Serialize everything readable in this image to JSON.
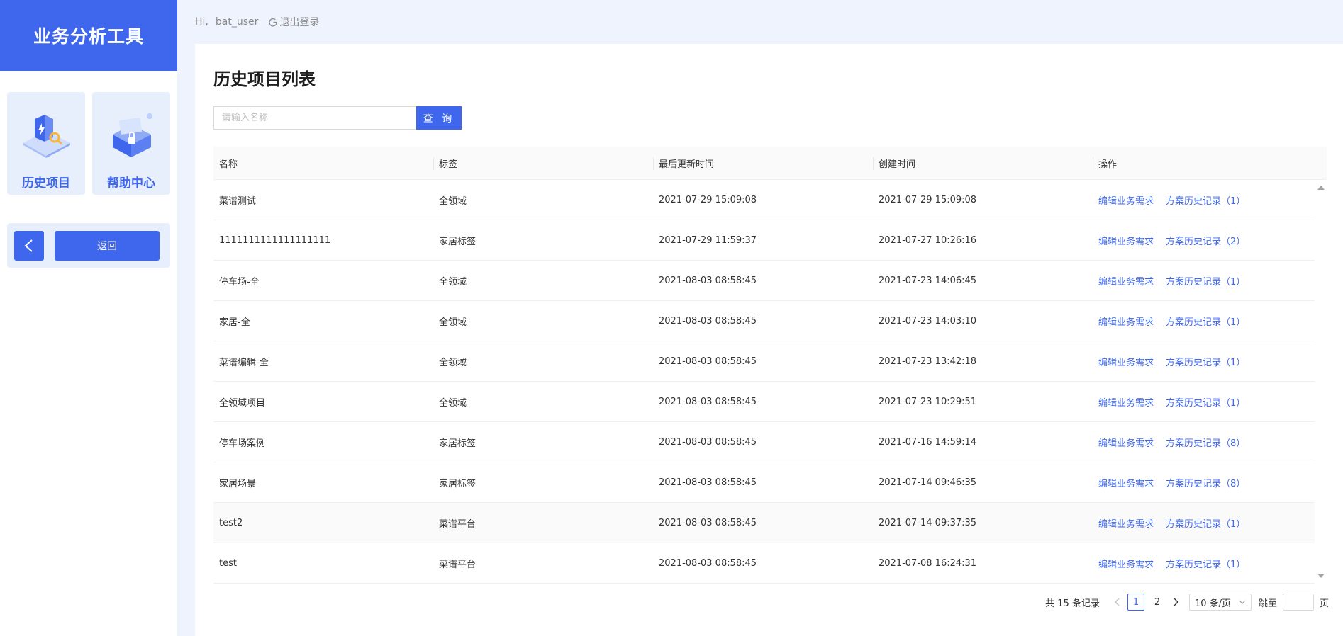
{
  "app": {
    "title": "业务分析工具"
  },
  "nav": {
    "cards": [
      {
        "label": "历史项目",
        "icon": "shield-magnifier-icon"
      },
      {
        "label": "帮助中心",
        "icon": "lock-box-icon"
      }
    ],
    "back_label": "返回"
  },
  "topbar": {
    "greeting": "Hi,",
    "user": "bat_user",
    "logout": "退出登录"
  },
  "page": {
    "title": "历史项目列表"
  },
  "search": {
    "placeholder": "请输入名称",
    "value": "",
    "button": "查 询"
  },
  "table": {
    "columns": [
      "名称",
      "标签",
      "最后更新时间",
      "创建时间",
      "操作"
    ],
    "action_edit": "编辑业务需求",
    "rows": [
      {
        "name": "菜谱测试",
        "tag": "全领域",
        "updated": "2021-07-29 15:09:08",
        "created": "2021-07-29 15:09:08",
        "history": "方案历史记录（1）"
      },
      {
        "name": "1111111111111111111",
        "tag": "家居标签",
        "updated": "2021-07-29 11:59:37",
        "created": "2021-07-27 10:26:16",
        "history": "方案历史记录（2）"
      },
      {
        "name": "停车场-全",
        "tag": "全领域",
        "updated": "2021-08-03 08:58:45",
        "created": "2021-07-23 14:06:45",
        "history": "方案历史记录（1）"
      },
      {
        "name": "家居-全",
        "tag": "全领域",
        "updated": "2021-08-03 08:58:45",
        "created": "2021-07-23 14:03:10",
        "history": "方案历史记录（1）"
      },
      {
        "name": "菜谱编辑-全",
        "tag": "全领域",
        "updated": "2021-08-03 08:58:45",
        "created": "2021-07-23 13:42:18",
        "history": "方案历史记录（1）"
      },
      {
        "name": "全领域项目",
        "tag": "全领域",
        "updated": "2021-08-03 08:58:45",
        "created": "2021-07-23 10:29:51",
        "history": "方案历史记录（1）"
      },
      {
        "name": "停车场案例",
        "tag": "家居标签",
        "updated": "2021-08-03 08:58:45",
        "created": "2021-07-16 14:59:14",
        "history": "方案历史记录（8）"
      },
      {
        "name": "家居场景",
        "tag": "家居标签",
        "updated": "2021-08-03 08:58:45",
        "created": "2021-07-14 09:46:35",
        "history": "方案历史记录（8）"
      },
      {
        "name": "test2",
        "tag": "菜谱平台",
        "updated": "2021-08-03 08:58:45",
        "created": "2021-07-14 09:37:35",
        "history": "方案历史记录（1）"
      },
      {
        "name": "test",
        "tag": "菜谱平台",
        "updated": "2021-08-03 08:58:45",
        "created": "2021-07-08 16:24:31",
        "history": "方案历史记录（1）"
      }
    ]
  },
  "pagination": {
    "total": "共 15 条记录",
    "pages": [
      "1",
      "2"
    ],
    "current": "1",
    "page_size": "10 条/页",
    "jump_label": "跳至",
    "page_unit": "页"
  },
  "colors": {
    "primary": "#3f67ee",
    "background": "#eef3fd",
    "card": "#e8effc"
  }
}
